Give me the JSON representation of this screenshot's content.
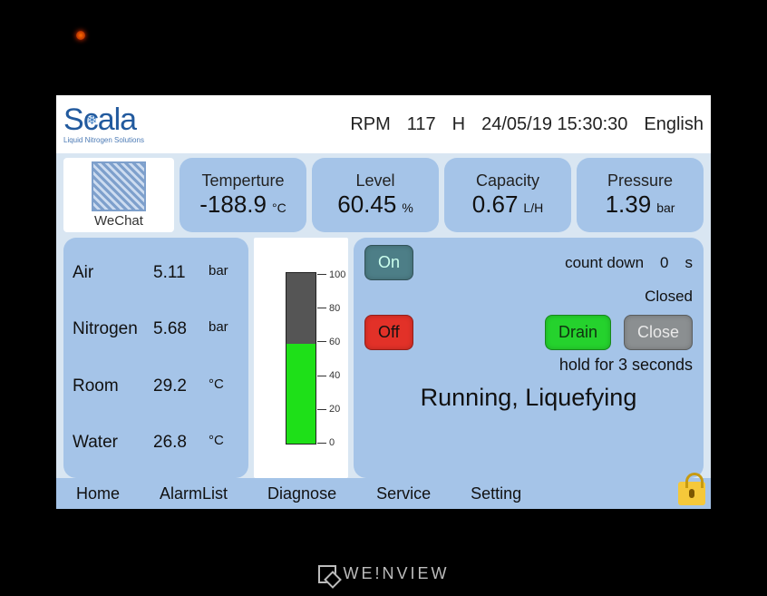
{
  "brand": {
    "name": "Scala",
    "tagline": "Liquid Nitrogen Solutions"
  },
  "top": {
    "rpm_label": "RPM",
    "rpm_value": "117",
    "rpm_unit": "H",
    "datetime": "24/05/19 15:30:30",
    "language": "English"
  },
  "wechat_label": "WeChat",
  "metrics": {
    "temp": {
      "title": "Temperture",
      "value": "-188.9",
      "unit": "°C"
    },
    "level": {
      "title": "Level",
      "value": "60.45",
      "unit": "%"
    },
    "cap": {
      "title": "Capacity",
      "value": "0.67",
      "unit": "L/H"
    },
    "press": {
      "title": "Pressure",
      "value": "1.39",
      "unit": "bar"
    }
  },
  "sensors": [
    {
      "label": "Air",
      "value": "5.11",
      "unit": "bar"
    },
    {
      "label": "Nitrogen",
      "value": "5.68",
      "unit": "bar"
    },
    {
      "label": "Room",
      "value": "29.2",
      "unit": "°C"
    },
    {
      "label": "Water",
      "value": "26.8",
      "unit": "°C"
    }
  ],
  "gauge": {
    "ticks": [
      "100",
      "80",
      "60",
      "40",
      "20",
      "0"
    ],
    "fill_percent": 58
  },
  "controls": {
    "on_label": "On",
    "off_label": "Off",
    "countdown_label": "count down",
    "countdown_value": "0",
    "countdown_unit": "s",
    "closed_label": "Closed",
    "drain_label": "Drain",
    "close_label": "Close",
    "hold_label": "hold for 3 seconds",
    "status": "Running, Liquefying"
  },
  "nav": {
    "home": "Home",
    "alarm": "AlarmList",
    "diag": "Diagnose",
    "service": "Service",
    "setting": "Setting"
  },
  "device_brand": "WE!NVIEW"
}
